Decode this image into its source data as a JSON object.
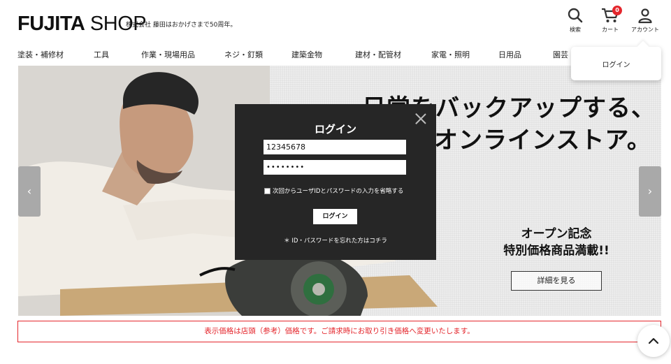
{
  "header": {
    "logo_bold": "FUJITA",
    "logo_light": "SHOP",
    "tagline": "株式会社 藤田はおかげさまで50周年。",
    "search_label": "検索",
    "cart_label": "カート",
    "cart_count": "0",
    "account_label": "アカウント"
  },
  "nav": {
    "items": [
      "塗装・補修材",
      "工具",
      "作業・現場用品",
      "ネジ・釘類",
      "建築金物",
      "建材・配管材",
      "家電・照明",
      "日用品",
      "園芸"
    ]
  },
  "account_dropdown": {
    "login_label": "ログイン"
  },
  "hero": {
    "headline_line1": "日常をバックアップする、",
    "headline_line2": "のオンラインストア。",
    "promo_line1": "オープン記念",
    "promo_line2": "特別価格商品満載!!",
    "detail_button": "詳細を見る",
    "prev_arrow": "‹",
    "next_arrow": "›"
  },
  "login_modal": {
    "title": "ログイン",
    "id_value": "12345678",
    "password_value": "••••••••",
    "remember_label": "次回からユーザIDとパスワードの入力を省略する",
    "login_button": "ログイン",
    "forgot_link": "＊ ID・パスワードを忘れた方はコチラ"
  },
  "notice": {
    "text": "表示価格は店頭（参考）価格です。ご請求時にお取り引き価格へ変更いたします。"
  },
  "colors": {
    "accent_red": "#e4262c",
    "modal_bg": "#262626"
  }
}
